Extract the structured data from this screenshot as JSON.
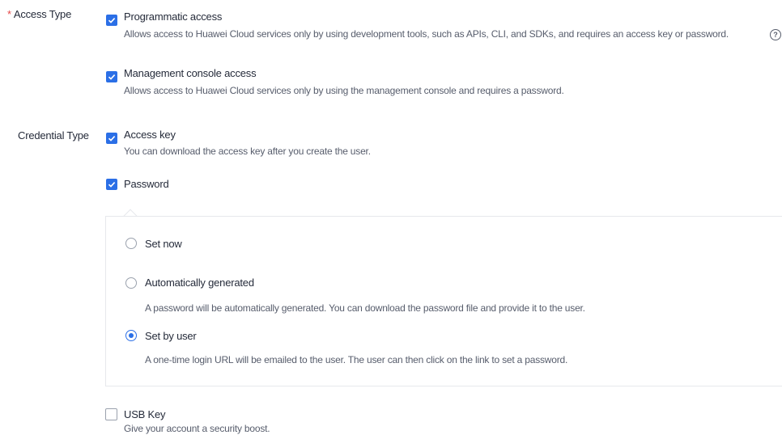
{
  "access_type": {
    "required_mark": "*",
    "label": "Access Type",
    "options": [
      {
        "title": "Programmatic access",
        "desc": "Allows access to Huawei Cloud services only by using development tools, such as APIs, CLI, and SDKs, and requires an access key or password.",
        "checked": true
      },
      {
        "title": "Management console access",
        "desc": "Allows access to Huawei Cloud services only by using the management console and requires a password.",
        "checked": true
      }
    ],
    "help_glyph": "?"
  },
  "credential_type": {
    "label": "Credential Type",
    "access_key": {
      "title": "Access key",
      "desc": "You can download the access key after you create the user.",
      "checked": true
    },
    "password": {
      "title": "Password",
      "checked": true,
      "radios": [
        {
          "label": "Set now",
          "selected": false,
          "desc": ""
        },
        {
          "label": "Automatically generated",
          "selected": false,
          "desc": "A password will be automatically generated. You can download the password file and provide it to the user."
        },
        {
          "label": "Set by user",
          "selected": true,
          "desc": "A one-time login URL will be emailed to the user. The user can then click on the link to set a password."
        }
      ]
    },
    "usb_key": {
      "title": "USB Key",
      "desc": "Give your account a security boost.",
      "checked": false
    }
  },
  "colors": {
    "accent": "#2b6fe6",
    "required": "#e54545",
    "text": "#252b3a",
    "muted": "#575d6c"
  }
}
